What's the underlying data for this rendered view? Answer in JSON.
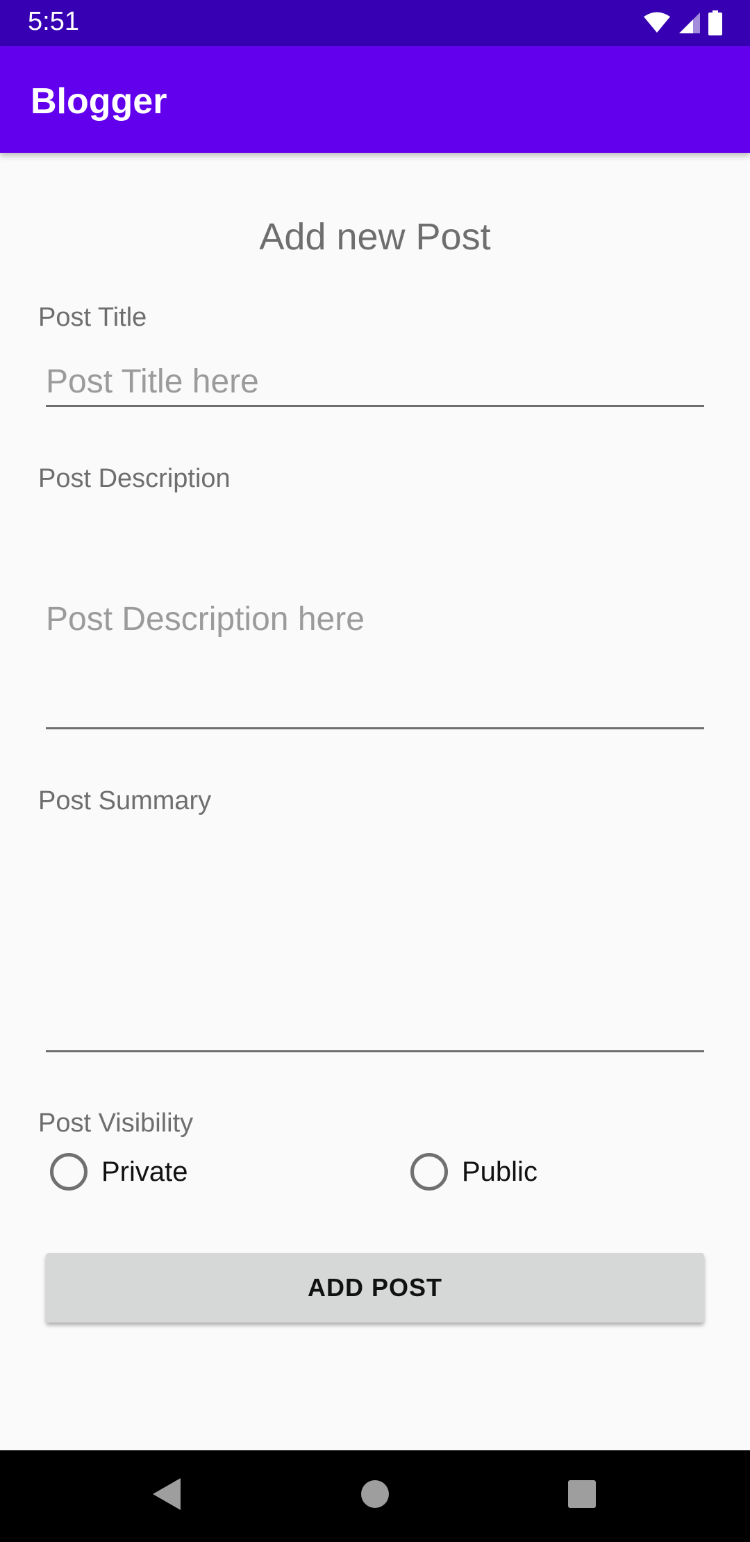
{
  "status_bar": {
    "time": "5:51",
    "icons": [
      "wifi-icon",
      "cellular-icon",
      "battery-icon"
    ]
  },
  "app_bar": {
    "title": "Blogger"
  },
  "form": {
    "heading": "Add new Post",
    "title_label": "Post Title",
    "title_placeholder": "Post Title here",
    "title_value": "",
    "description_label": "Post Description",
    "description_placeholder": "Post Description here",
    "description_value": "",
    "summary_label": "Post Summary",
    "summary_placeholder": "",
    "summary_value": "",
    "visibility_label": "Post Visibility",
    "visibility_options": [
      {
        "label": "Private",
        "selected": false
      },
      {
        "label": "Public",
        "selected": false
      }
    ],
    "submit_label": "ADD POST"
  },
  "nav_bar": {
    "buttons": [
      "back-icon",
      "home-icon",
      "recents-icon"
    ]
  },
  "colors": {
    "status_bar": "#3700b3",
    "app_bar": "#6200ee",
    "background": "#fafafa",
    "button": "#d6d7d7"
  }
}
